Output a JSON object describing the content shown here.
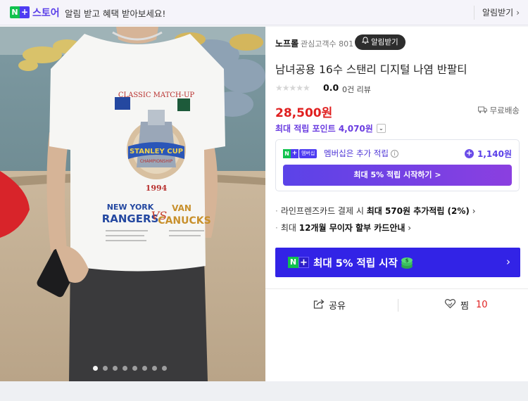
{
  "topbar": {
    "badge_n": "N",
    "badge_plus": "+",
    "store_label": "스토어",
    "promo_text": "알림 받고 혜택 받아보세요!",
    "alarm_link": "알림받기"
  },
  "photo": {
    "shirt_lines": [
      "CLASSIC MATCH-UP",
      "STANLEY CUP",
      "CHAMPIONSHIP",
      "1994",
      "NEW YORK",
      "RANGERS",
      "VS",
      "VAN",
      "CANUCKS"
    ],
    "carousel_dots": 8,
    "active_dot": 1
  },
  "product": {
    "seller": "노프롤",
    "followers": "관심고객수 801",
    "alarm_button": "알림받기",
    "title": "남녀공용 16수 스탠리 디지털 나염 반팔티",
    "stars": "★★★★★",
    "rating": "0.0",
    "review_count": "0건 리뷰",
    "price": "28,500원",
    "shipping": "무료배송",
    "max_points": "최대 적립 포인트 4,070원"
  },
  "membership": {
    "badge_text": "멤버십",
    "label": "멤버십은 추가 적립",
    "points": "1,140원",
    "start_button": "최대 5% 적립 시작하기 >"
  },
  "card_benefits": {
    "line1_prefix": "라인프렌즈카드 결제 시 ",
    "line1_bold": "최대 570원 추가적립 (2%)",
    "line2_prefix": "최대 ",
    "line2_bold": "12개월 무이자 할부 카드안내"
  },
  "cta": {
    "label": "최대 5% 적립 시작"
  },
  "actions": {
    "share": "공유",
    "zzim": "찜",
    "zzim_count": "10"
  },
  "colors": {
    "accent_purple": "#5a3fe8",
    "price_red": "#e02020",
    "naver_green": "#10c24e",
    "cta_blue": "#3223e6"
  }
}
